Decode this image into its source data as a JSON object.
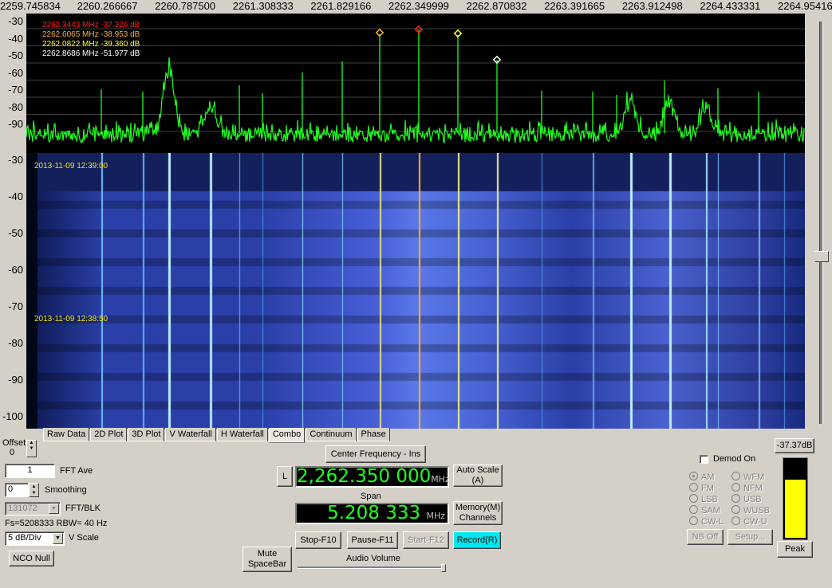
{
  "freq_axis": {
    "labels": [
      "2259.745834",
      "2260.266667",
      "2260.787500",
      "2261.308333",
      "2261.829166",
      "2262.349999",
      "2262.870832",
      "2263.391665",
      "2263.912498",
      "2264.433331",
      "2264.95416"
    ]
  },
  "spectrum": {
    "y_labels": [
      "-30",
      "-40",
      "-50",
      "-60",
      "-70",
      "-80",
      "-90"
    ],
    "markers": [
      {
        "text": "2262.3443 MHz  -37.326 dB",
        "color": "#ff2020"
      },
      {
        "text": "2262.6065 MHz  -38.953 dB",
        "color": "#ffb040"
      },
      {
        "text": "2262.0822 MHz  -39.360 dB",
        "color": "#ffff40"
      },
      {
        "text": "2262.8686 MHz  -51.977 dB",
        "color": "#ffffff"
      }
    ]
  },
  "waterfall": {
    "y_labels": [
      "-30",
      "-40",
      "-50",
      "-60",
      "-70",
      "-80",
      "-90",
      "-100"
    ],
    "timestamps": [
      "2013-11-09 12:39:00",
      "2013-11-09 12:38:50"
    ]
  },
  "tabs": [
    "Raw Data",
    "2D Plot",
    "3D Plot",
    "V Waterfall",
    "H Waterfall",
    "Combo",
    "Continuum",
    "Phase"
  ],
  "active_tab": "Combo",
  "controls": {
    "offset_label": "Offset",
    "offset_value": "0",
    "fft_ave_value": "1",
    "fft_ave_label": "FFT Ave",
    "smoothing_value": "0",
    "smoothing_label": "Smoothing",
    "fft_blk_value": "131072",
    "fft_blk_label": "FFT/BLK",
    "fs_text": "Fs=5208333 RBW=  40 Hz",
    "vscale_value": "5 dB/Div",
    "vscale_label": "V Scale",
    "nco_null": "NCO Null",
    "mute": "Mute\nSpaceBar",
    "center_freq_btn": "Center Frequency - Ins",
    "l_btn": "L",
    "center_freq_value": "2,262.350 000",
    "mhz": "MHz",
    "span_label": "Span",
    "span_value": "5.208 333",
    "auto_scale": "Auto Scale\n(A)",
    "memory": "Memory(M)\nChannels",
    "stop": "Stop-F10",
    "pause": "Pause-F11",
    "start": "Start-F12",
    "record": "Record(R)",
    "audio_volume": "Audio Volume"
  },
  "demod": {
    "checkbox_label": "Demod On",
    "modes": [
      [
        "AM",
        "WFM"
      ],
      [
        "FM",
        "NFM"
      ],
      [
        "LSB",
        "USB"
      ],
      [
        "SAM",
        "WUSB"
      ],
      [
        "CW-L",
        "CW-U"
      ]
    ],
    "selected": "AM",
    "nb_off": "NB Off",
    "setup": "Setup..."
  },
  "meter": {
    "value_label": "-37.37dB",
    "level": 0.74,
    "peak": "Peak"
  }
}
